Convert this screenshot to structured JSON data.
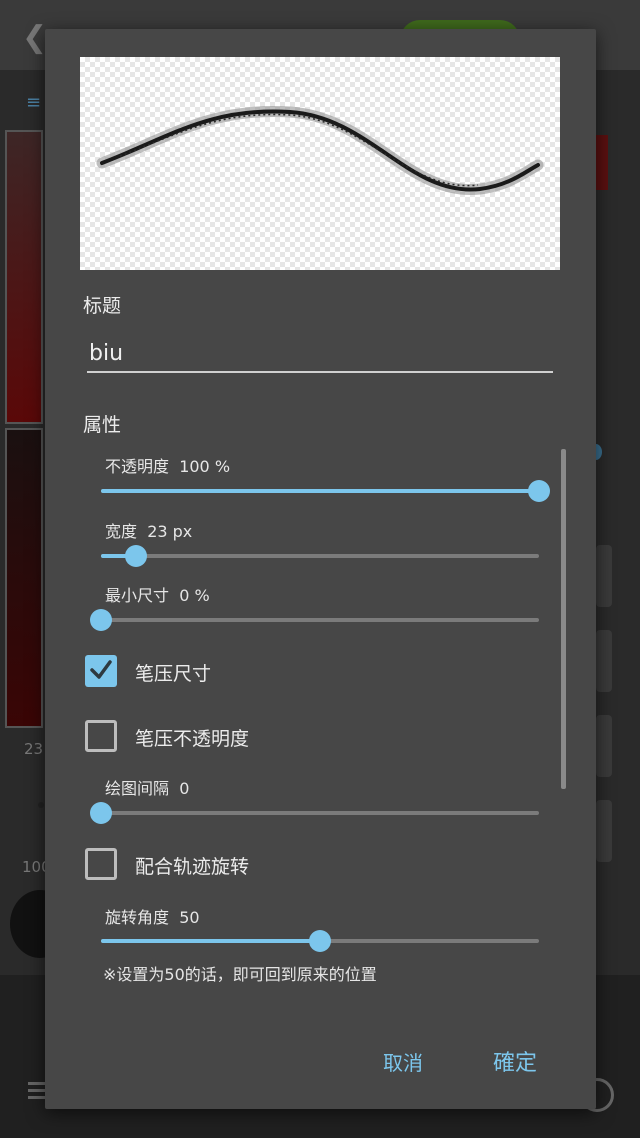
{
  "dialog": {
    "title_label": "标题",
    "name_value": "biu",
    "properties_label": "属性",
    "opacity": {
      "label": "不透明度",
      "value": "100",
      "unit": "%",
      "fraction": 1.0
    },
    "width": {
      "label": "宽度",
      "value": "23",
      "unit": "px",
      "fraction": 0.08
    },
    "min_size": {
      "label": "最小尺寸",
      "value": "0",
      "unit": "%",
      "fraction": 0.0
    },
    "pressure_size": {
      "label": "笔压尺寸",
      "checked": true
    },
    "pressure_opacity": {
      "label": "笔压不透明度",
      "checked": false
    },
    "spacing": {
      "label": "绘图间隔",
      "value": "0",
      "fraction": 0.0
    },
    "follow_rotation": {
      "label": "配合轨迹旋转",
      "checked": false
    },
    "rotation_angle": {
      "label": "旋转角度",
      "value": "50",
      "fraction": 0.5
    },
    "hint": "※设置为50的话，即可回到原来的位置",
    "cancel_label": "取消",
    "ok_label": "確定"
  },
  "background": {
    "left_value_1": "23",
    "left_value_2": "100"
  },
  "colors": {
    "accent": "#7cc6ec",
    "dialog_bg": "#474747",
    "track": "#7b7b7b"
  }
}
